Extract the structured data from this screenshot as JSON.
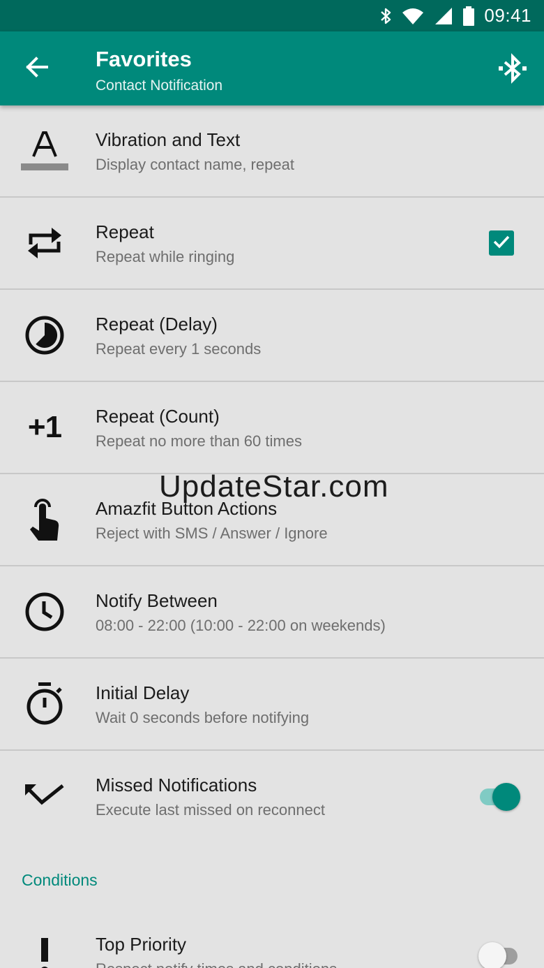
{
  "status_bar": {
    "time": "09:41",
    "icons": [
      "bluetooth-icon",
      "wifi-icon",
      "signal-icon",
      "battery-icon"
    ]
  },
  "app_bar": {
    "title": "Favorites",
    "subtitle": "Contact Notification",
    "back_icon": "arrow-left-icon",
    "action_icon": "bluetooth-connect-icon"
  },
  "settings": [
    {
      "icon": "text-format-icon",
      "title": "Vibration and Text",
      "summary": "Display contact name, repeat"
    },
    {
      "icon": "repeat-icon",
      "title": "Repeat",
      "summary": "Repeat while ringing",
      "checkbox": true
    },
    {
      "icon": "timelapse-icon",
      "title": "Repeat (Delay)",
      "summary": "Repeat every 1 seconds"
    },
    {
      "icon": "plus-one-icon",
      "icon_text": "+1",
      "title": "Repeat (Count)",
      "summary": "Repeat no more than 60 times"
    },
    {
      "icon": "touch-app-icon",
      "title": "Amazfit Button Actions",
      "summary": "Reject with SMS / Answer / Ignore"
    },
    {
      "icon": "clock-icon",
      "title": "Notify Between",
      "summary": "08:00 - 22:00 (10:00 - 22:00 on weekends)"
    },
    {
      "icon": "timer-icon",
      "title": "Initial Delay",
      "summary": "Wait 0 seconds before notifying"
    },
    {
      "icon": "call-missed-icon",
      "title": "Missed Notifications",
      "summary": "Execute last missed on reconnect",
      "switch": true
    }
  ],
  "conditions": {
    "header": "Conditions",
    "items": [
      {
        "icon": "priority-icon",
        "title": "Top Priority",
        "summary": "Respect notify times and conditions",
        "switch": false
      }
    ]
  },
  "watermark": "UpdateStar.com",
  "colors": {
    "primary": "#00897b",
    "primary_dark": "#00695c",
    "accent": "#00897b",
    "background": "#e3e3e3"
  }
}
